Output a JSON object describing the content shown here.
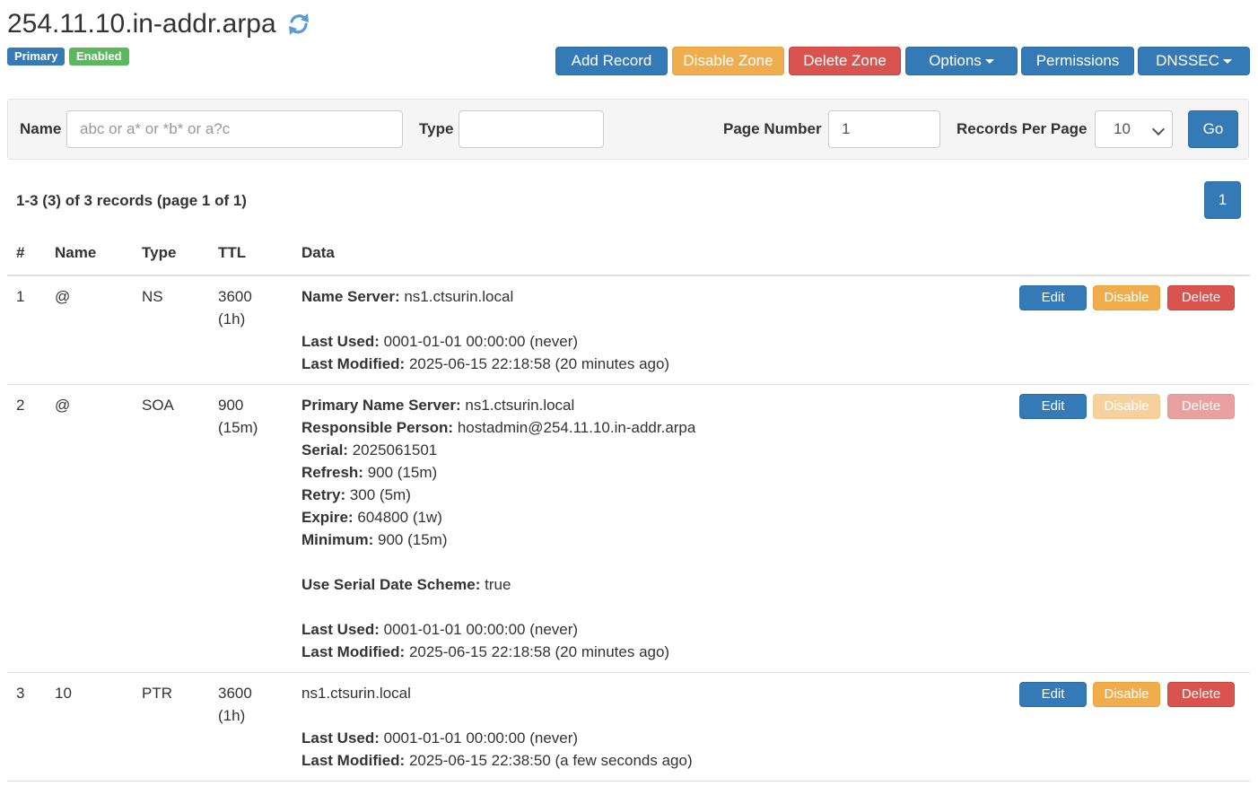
{
  "zone": {
    "title": "254.11.10.in-addr.arpa",
    "badge_type": "Primary",
    "badge_status": "Enabled"
  },
  "toolbar": {
    "add_record": "Add Record",
    "disable_zone": "Disable Zone",
    "delete_zone": "Delete Zone",
    "options": "Options",
    "permissions": "Permissions",
    "dnssec": "DNSSEC"
  },
  "filter": {
    "name_label": "Name",
    "name_placeholder": "abc or a* or *b* or a?c",
    "name_value": "",
    "type_label": "Type",
    "type_value": "",
    "page_number_label": "Page Number",
    "page_number_value": "1",
    "records_per_page_label": "Records Per Page",
    "records_per_page_value": "10",
    "go_label": "Go"
  },
  "summary": "1-3 (3) of 3 records (page 1 of 1)",
  "pagination": {
    "current_page": "1"
  },
  "table": {
    "headers": [
      "#",
      "Name",
      "Type",
      "TTL",
      "Data"
    ],
    "rows": [
      {
        "index": "1",
        "name": "@",
        "type": "NS",
        "ttl": "3600",
        "ttl_human": "(1h)",
        "fields": [
          {
            "label": "Name Server:",
            "value": " ns1.ctsurin.local"
          },
          {
            "label": "",
            "value": ""
          },
          {
            "label": "Last Used:",
            "value": " 0001-01-01 00:00:00 (never)"
          },
          {
            "label": "Last Modified:",
            "value": " 2025-06-15 22:18:58 (20 minutes ago)"
          }
        ],
        "actions": {
          "edit": "Edit",
          "disable": "Disable",
          "delete": "Delete",
          "disabled": false
        }
      },
      {
        "index": "2",
        "name": "@",
        "type": "SOA",
        "ttl": "900",
        "ttl_human": "(15m)",
        "fields": [
          {
            "label": "Primary Name Server:",
            "value": " ns1.ctsurin.local"
          },
          {
            "label": "Responsible Person:",
            "value": " hostadmin@254.11.10.in-addr.arpa"
          },
          {
            "label": "Serial:",
            "value": " 2025061501"
          },
          {
            "label": "Refresh:",
            "value": " 900 (15m)"
          },
          {
            "label": "Retry:",
            "value": " 300 (5m)"
          },
          {
            "label": "Expire:",
            "value": " 604800 (1w)"
          },
          {
            "label": "Minimum:",
            "value": " 900 (15m)"
          },
          {
            "label": "",
            "value": ""
          },
          {
            "label": "Use Serial Date Scheme:",
            "value": " true"
          },
          {
            "label": "",
            "value": ""
          },
          {
            "label": "Last Used:",
            "value": " 0001-01-01 00:00:00 (never)"
          },
          {
            "label": "Last Modified:",
            "value": " 2025-06-15 22:18:58 (20 minutes ago)"
          }
        ],
        "actions": {
          "edit": "Edit",
          "disable": "Disable",
          "delete": "Delete",
          "disabled": true
        }
      },
      {
        "index": "3",
        "name": "10",
        "type": "PTR",
        "ttl": "3600",
        "ttl_human": "(1h)",
        "fields": [
          {
            "label": "",
            "value": "ns1.ctsurin.local"
          },
          {
            "label": "",
            "value": ""
          },
          {
            "label": "Last Used:",
            "value": " 0001-01-01 00:00:00 (never)"
          },
          {
            "label": "Last Modified:",
            "value": " 2025-06-15 22:38:50 (a few seconds ago)"
          }
        ],
        "actions": {
          "edit": "Edit",
          "disable": "Disable",
          "delete": "Delete",
          "disabled": false
        }
      }
    ]
  },
  "colors": {
    "primary": "#337ab7",
    "warning": "#f0ad4e",
    "danger": "#d9534f",
    "success": "#5cb85c"
  }
}
